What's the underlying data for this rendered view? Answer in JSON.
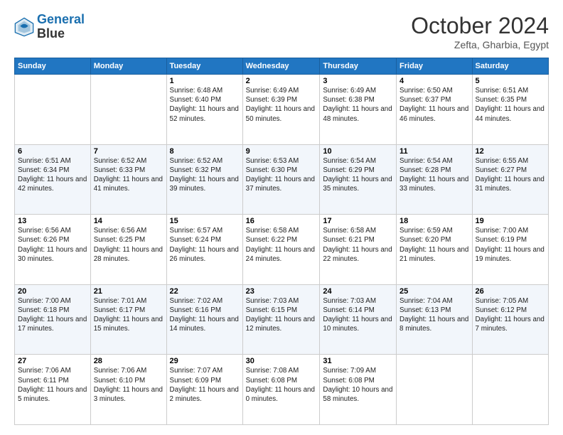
{
  "header": {
    "logo": {
      "line1": "General",
      "line2": "Blue"
    },
    "title": "October 2024",
    "location": "Zefta, Gharbia, Egypt"
  },
  "weekdays": [
    "Sunday",
    "Monday",
    "Tuesday",
    "Wednesday",
    "Thursday",
    "Friday",
    "Saturday"
  ],
  "weeks": [
    [
      {
        "day": null,
        "info": null
      },
      {
        "day": null,
        "info": null
      },
      {
        "day": "1",
        "sunrise": "Sunrise: 6:48 AM",
        "sunset": "Sunset: 6:40 PM",
        "daylight": "Daylight: 11 hours and 52 minutes."
      },
      {
        "day": "2",
        "sunrise": "Sunrise: 6:49 AM",
        "sunset": "Sunset: 6:39 PM",
        "daylight": "Daylight: 11 hours and 50 minutes."
      },
      {
        "day": "3",
        "sunrise": "Sunrise: 6:49 AM",
        "sunset": "Sunset: 6:38 PM",
        "daylight": "Daylight: 11 hours and 48 minutes."
      },
      {
        "day": "4",
        "sunrise": "Sunrise: 6:50 AM",
        "sunset": "Sunset: 6:37 PM",
        "daylight": "Daylight: 11 hours and 46 minutes."
      },
      {
        "day": "5",
        "sunrise": "Sunrise: 6:51 AM",
        "sunset": "Sunset: 6:35 PM",
        "daylight": "Daylight: 11 hours and 44 minutes."
      }
    ],
    [
      {
        "day": "6",
        "sunrise": "Sunrise: 6:51 AM",
        "sunset": "Sunset: 6:34 PM",
        "daylight": "Daylight: 11 hours and 42 minutes."
      },
      {
        "day": "7",
        "sunrise": "Sunrise: 6:52 AM",
        "sunset": "Sunset: 6:33 PM",
        "daylight": "Daylight: 11 hours and 41 minutes."
      },
      {
        "day": "8",
        "sunrise": "Sunrise: 6:52 AM",
        "sunset": "Sunset: 6:32 PM",
        "daylight": "Daylight: 11 hours and 39 minutes."
      },
      {
        "day": "9",
        "sunrise": "Sunrise: 6:53 AM",
        "sunset": "Sunset: 6:30 PM",
        "daylight": "Daylight: 11 hours and 37 minutes."
      },
      {
        "day": "10",
        "sunrise": "Sunrise: 6:54 AM",
        "sunset": "Sunset: 6:29 PM",
        "daylight": "Daylight: 11 hours and 35 minutes."
      },
      {
        "day": "11",
        "sunrise": "Sunrise: 6:54 AM",
        "sunset": "Sunset: 6:28 PM",
        "daylight": "Daylight: 11 hours and 33 minutes."
      },
      {
        "day": "12",
        "sunrise": "Sunrise: 6:55 AM",
        "sunset": "Sunset: 6:27 PM",
        "daylight": "Daylight: 11 hours and 31 minutes."
      }
    ],
    [
      {
        "day": "13",
        "sunrise": "Sunrise: 6:56 AM",
        "sunset": "Sunset: 6:26 PM",
        "daylight": "Daylight: 11 hours and 30 minutes."
      },
      {
        "day": "14",
        "sunrise": "Sunrise: 6:56 AM",
        "sunset": "Sunset: 6:25 PM",
        "daylight": "Daylight: 11 hours and 28 minutes."
      },
      {
        "day": "15",
        "sunrise": "Sunrise: 6:57 AM",
        "sunset": "Sunset: 6:24 PM",
        "daylight": "Daylight: 11 hours and 26 minutes."
      },
      {
        "day": "16",
        "sunrise": "Sunrise: 6:58 AM",
        "sunset": "Sunset: 6:22 PM",
        "daylight": "Daylight: 11 hours and 24 minutes."
      },
      {
        "day": "17",
        "sunrise": "Sunrise: 6:58 AM",
        "sunset": "Sunset: 6:21 PM",
        "daylight": "Daylight: 11 hours and 22 minutes."
      },
      {
        "day": "18",
        "sunrise": "Sunrise: 6:59 AM",
        "sunset": "Sunset: 6:20 PM",
        "daylight": "Daylight: 11 hours and 21 minutes."
      },
      {
        "day": "19",
        "sunrise": "Sunrise: 7:00 AM",
        "sunset": "Sunset: 6:19 PM",
        "daylight": "Daylight: 11 hours and 19 minutes."
      }
    ],
    [
      {
        "day": "20",
        "sunrise": "Sunrise: 7:00 AM",
        "sunset": "Sunset: 6:18 PM",
        "daylight": "Daylight: 11 hours and 17 minutes."
      },
      {
        "day": "21",
        "sunrise": "Sunrise: 7:01 AM",
        "sunset": "Sunset: 6:17 PM",
        "daylight": "Daylight: 11 hours and 15 minutes."
      },
      {
        "day": "22",
        "sunrise": "Sunrise: 7:02 AM",
        "sunset": "Sunset: 6:16 PM",
        "daylight": "Daylight: 11 hours and 14 minutes."
      },
      {
        "day": "23",
        "sunrise": "Sunrise: 7:03 AM",
        "sunset": "Sunset: 6:15 PM",
        "daylight": "Daylight: 11 hours and 12 minutes."
      },
      {
        "day": "24",
        "sunrise": "Sunrise: 7:03 AM",
        "sunset": "Sunset: 6:14 PM",
        "daylight": "Daylight: 11 hours and 10 minutes."
      },
      {
        "day": "25",
        "sunrise": "Sunrise: 7:04 AM",
        "sunset": "Sunset: 6:13 PM",
        "daylight": "Daylight: 11 hours and 8 minutes."
      },
      {
        "day": "26",
        "sunrise": "Sunrise: 7:05 AM",
        "sunset": "Sunset: 6:12 PM",
        "daylight": "Daylight: 11 hours and 7 minutes."
      }
    ],
    [
      {
        "day": "27",
        "sunrise": "Sunrise: 7:06 AM",
        "sunset": "Sunset: 6:11 PM",
        "daylight": "Daylight: 11 hours and 5 minutes."
      },
      {
        "day": "28",
        "sunrise": "Sunrise: 7:06 AM",
        "sunset": "Sunset: 6:10 PM",
        "daylight": "Daylight: 11 hours and 3 minutes."
      },
      {
        "day": "29",
        "sunrise": "Sunrise: 7:07 AM",
        "sunset": "Sunset: 6:09 PM",
        "daylight": "Daylight: 11 hours and 2 minutes."
      },
      {
        "day": "30",
        "sunrise": "Sunrise: 7:08 AM",
        "sunset": "Sunset: 6:08 PM",
        "daylight": "Daylight: 11 hours and 0 minutes."
      },
      {
        "day": "31",
        "sunrise": "Sunrise: 7:09 AM",
        "sunset": "Sunset: 6:08 PM",
        "daylight": "Daylight: 10 hours and 58 minutes."
      },
      {
        "day": null,
        "info": null
      },
      {
        "day": null,
        "info": null
      }
    ]
  ]
}
